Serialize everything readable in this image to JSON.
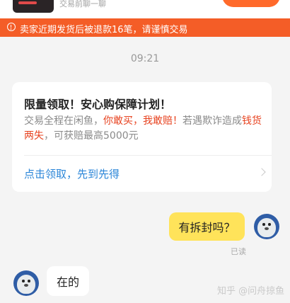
{
  "header": {
    "subtitle": "交易前聊一聊"
  },
  "warning": {
    "text": "卖家近期发货后被退款16笔，请谨慎交易"
  },
  "chat": {
    "timestamp": "09:21",
    "promo_card": {
      "title": "限量领取！安心购保障计划！",
      "body_1": "交易全程在闲鱼，",
      "body_2": "你敢买，我敢赔！",
      "body_3": "若遇欺诈造成",
      "body_4": "钱货两失",
      "body_5": "，可获赔最高5000元",
      "link_label": "点击领取，先到先得"
    },
    "messages": [
      {
        "side": "right",
        "text": "有拆封吗？",
        "status": "已读"
      },
      {
        "side": "left",
        "text": "在的"
      }
    ]
  },
  "watermark": "知乎 @问舟掠鱼",
  "colors": {
    "warning_bg": "#f45d27",
    "highlight": "#e7421f",
    "link": "#2b86d8",
    "my_bubble": "#ffe35a"
  }
}
